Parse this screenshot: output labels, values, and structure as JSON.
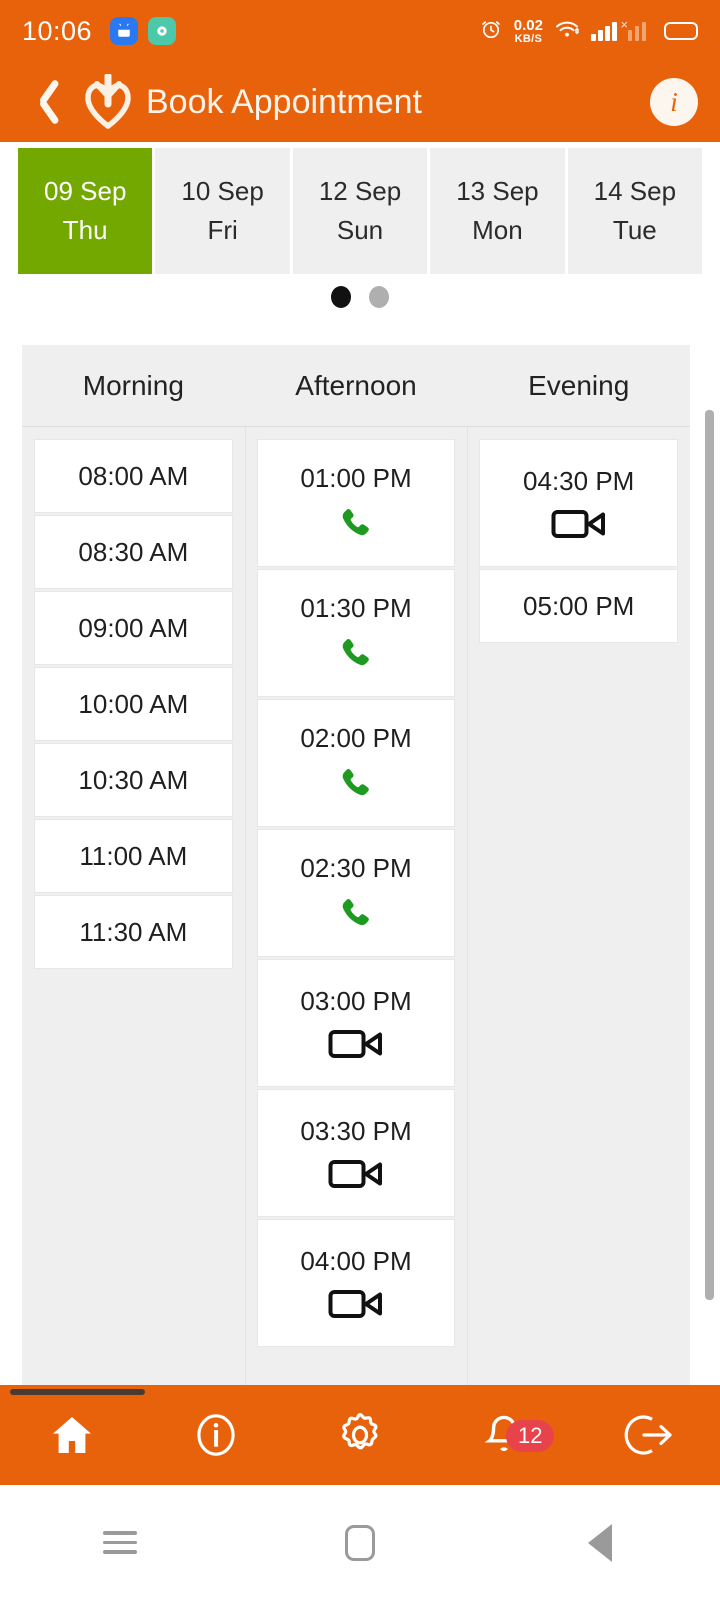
{
  "status_bar": {
    "time": "10:06",
    "network_speed_value": "0.02",
    "network_speed_unit": "KB/S",
    "icons": [
      "alarm-clock-icon",
      "app-notification-android-icon",
      "app-notification-teal-icon",
      "wifi-icon",
      "signal-bars-icon",
      "signal-no-sim-icon",
      "battery-icon"
    ]
  },
  "app_bar": {
    "back_label": "",
    "logo_name": "heart-cross-logo",
    "title": "Book Appointment",
    "info_label": "i"
  },
  "date_strip": {
    "dates": [
      {
        "date": "09 Sep",
        "day": "Thu",
        "selected": true
      },
      {
        "date": "10 Sep",
        "day": "Fri",
        "selected": false
      },
      {
        "date": "12 Sep",
        "day": "Sun",
        "selected": false
      },
      {
        "date": "13 Sep",
        "day": "Mon",
        "selected": false
      },
      {
        "date": "14 Sep",
        "day": "Tue",
        "selected": false
      }
    ],
    "pager": {
      "total": 2,
      "active_index": 0
    }
  },
  "slots_panel": {
    "headers": [
      "Morning",
      "Afternoon",
      "Evening"
    ],
    "columns": [
      {
        "name": "Morning",
        "slots": [
          {
            "time": "08:00 AM",
            "icon": "none"
          },
          {
            "time": "08:30 AM",
            "icon": "none"
          },
          {
            "time": "09:00 AM",
            "icon": "none"
          },
          {
            "time": "10:00 AM",
            "icon": "none"
          },
          {
            "time": "10:30 AM",
            "icon": "none"
          },
          {
            "time": "11:00 AM",
            "icon": "none"
          },
          {
            "time": "11:30 AM",
            "icon": "none"
          }
        ]
      },
      {
        "name": "Afternoon",
        "slots": [
          {
            "time": "01:00 PM",
            "icon": "phone"
          },
          {
            "time": "01:30 PM",
            "icon": "phone"
          },
          {
            "time": "02:00 PM",
            "icon": "phone"
          },
          {
            "time": "02:30 PM",
            "icon": "phone"
          },
          {
            "time": "03:00 PM",
            "icon": "video"
          },
          {
            "time": "03:30 PM",
            "icon": "video"
          },
          {
            "time": "04:00 PM",
            "icon": "video"
          }
        ]
      },
      {
        "name": "Evening",
        "slots": [
          {
            "time": "04:30 PM",
            "icon": "video"
          },
          {
            "time": "05:00 PM",
            "icon": "none"
          }
        ]
      }
    ]
  },
  "bottom_nav": {
    "items": [
      {
        "name": "home",
        "icon": "home-icon",
        "badge": null
      },
      {
        "name": "info",
        "icon": "info-circle-icon",
        "badge": null
      },
      {
        "name": "settings",
        "icon": "gear-icon",
        "badge": null
      },
      {
        "name": "notifications",
        "icon": "bell-icon",
        "badge": "12"
      },
      {
        "name": "logout",
        "icon": "logout-icon",
        "badge": null
      }
    ]
  },
  "android_nav": {
    "items": [
      "recents-icon",
      "home-icon",
      "back-icon"
    ]
  },
  "colors": {
    "brand_orange": "#E8620C",
    "selected_green": "#72A800",
    "badge_red": "#E8434A",
    "panel_gray": "#EFEFEF",
    "phone_icon_green": "#1F9A21"
  }
}
